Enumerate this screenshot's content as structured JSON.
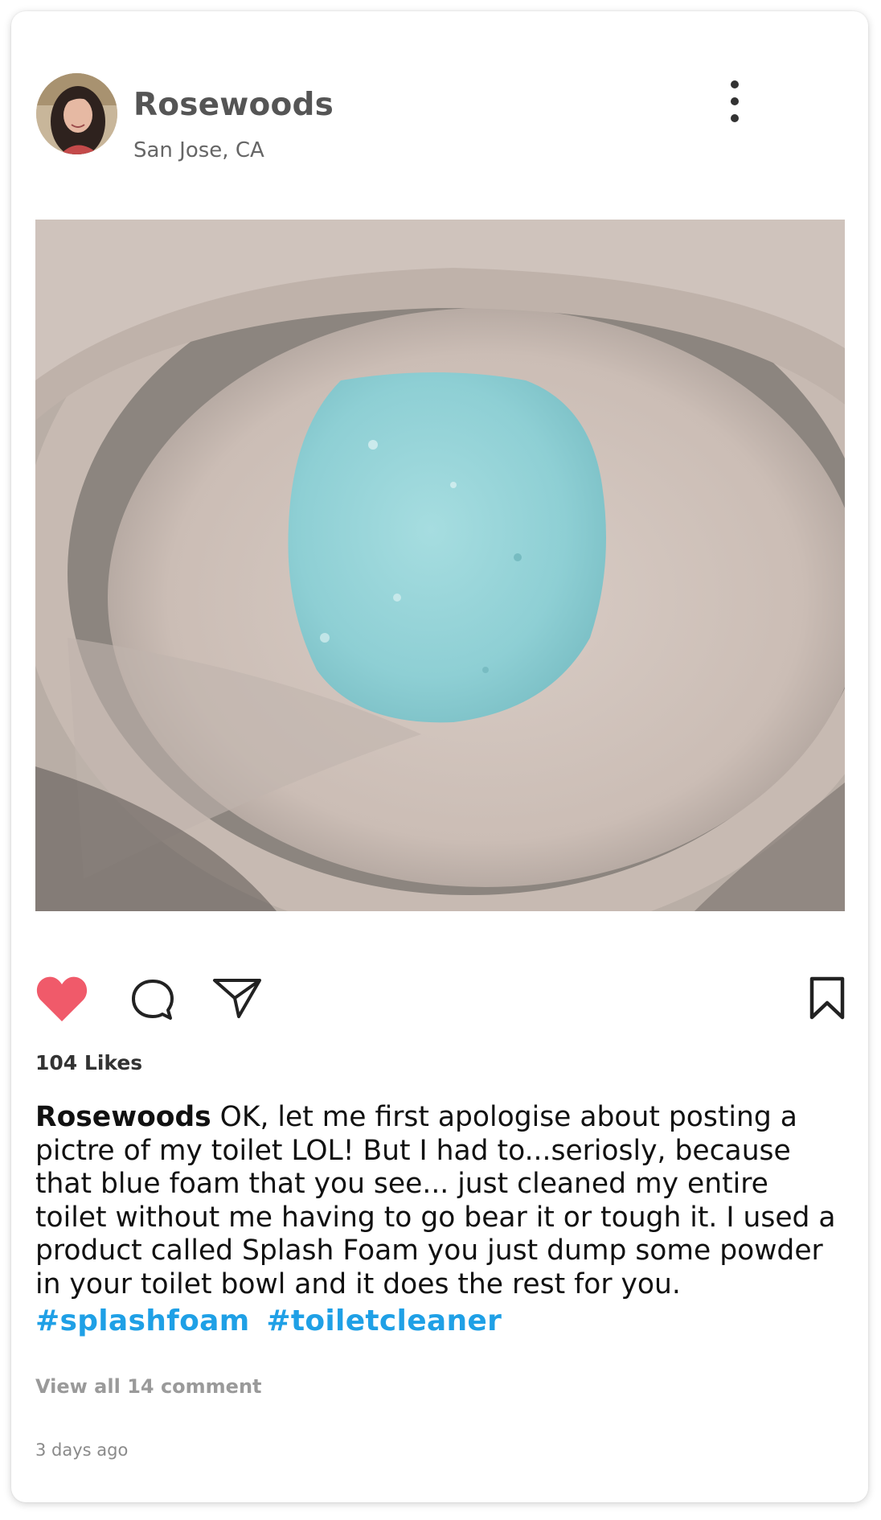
{
  "post": {
    "username": "Rosewoods",
    "location": "San Jose, CA",
    "likes_text": "104 Likes",
    "caption_user": "Rosewoods",
    "caption_text": " OK, let me first apologise about posting a pictre of my toilet LOL! But I had to...seriosly, because that blue foam that you see... just cleaned my entire toilet without me having to go bear it or tough it. I used a product called Splash Foam you just dump some powder in your toilet bowl and it does the rest for you.",
    "hashtags": [
      "#splashfoam",
      "#toiletcleaner"
    ],
    "view_comments": "View all 14 comment",
    "timestamp": "3 days ago"
  },
  "icons": {
    "like": "heart-icon",
    "comment": "comment-bubble-icon",
    "share": "paper-plane-icon",
    "save": "bookmark-icon",
    "more": "more-options-icon"
  },
  "colors": {
    "like_heart": "#f05a6a",
    "hashtag": "#1fa0e6",
    "foam": "#8ecfd4"
  }
}
